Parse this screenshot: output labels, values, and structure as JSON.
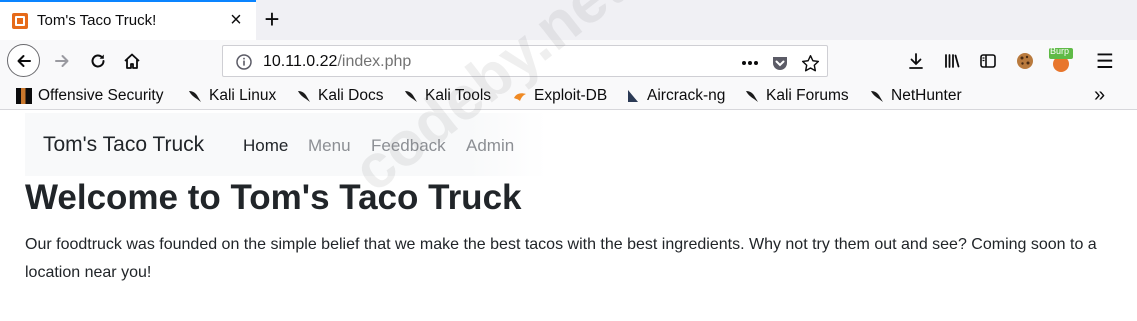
{
  "tab": {
    "title": "Tom's Taco Truck!",
    "close": "×",
    "new_tab": "+"
  },
  "url": {
    "host": "10.11.0.22",
    "path": "/index.php"
  },
  "toolbar": {
    "burp_badge": "Burp",
    "menu": "☰",
    "overflow": "»"
  },
  "bookmarks": [
    {
      "label": "Offensive Security",
      "icon": "offsec-icon"
    },
    {
      "label": "Kali Linux",
      "icon": "kali-dragon-icon"
    },
    {
      "label": "Kali Docs",
      "icon": "kali-dragon-icon"
    },
    {
      "label": "Kali Tools",
      "icon": "kali-dragon-icon"
    },
    {
      "label": "Exploit-DB",
      "icon": "exploit-db-icon"
    },
    {
      "label": "Aircrack-ng",
      "icon": "aircrack-icon"
    },
    {
      "label": "Kali Forums",
      "icon": "kali-dragon-icon"
    },
    {
      "label": "NetHunter",
      "icon": "kali-dragon-icon"
    }
  ],
  "site": {
    "brand": "Tom's Taco Truck",
    "nav": [
      "Home",
      "Menu",
      "Feedback",
      "Admin"
    ],
    "headline": "Welcome to Tom's Taco Truck",
    "paragraph": "Our foodtruck was founded on the simple belief that we make the best tacos with the best ingredients. Why not try them out and see? Coming soon to a location near you!"
  },
  "watermark": "codeby.net",
  "colors": {
    "accent": "#0a84ff",
    "favicon": "#e66a19",
    "nav_inactive": "#8c8f94",
    "text": "#212529"
  }
}
